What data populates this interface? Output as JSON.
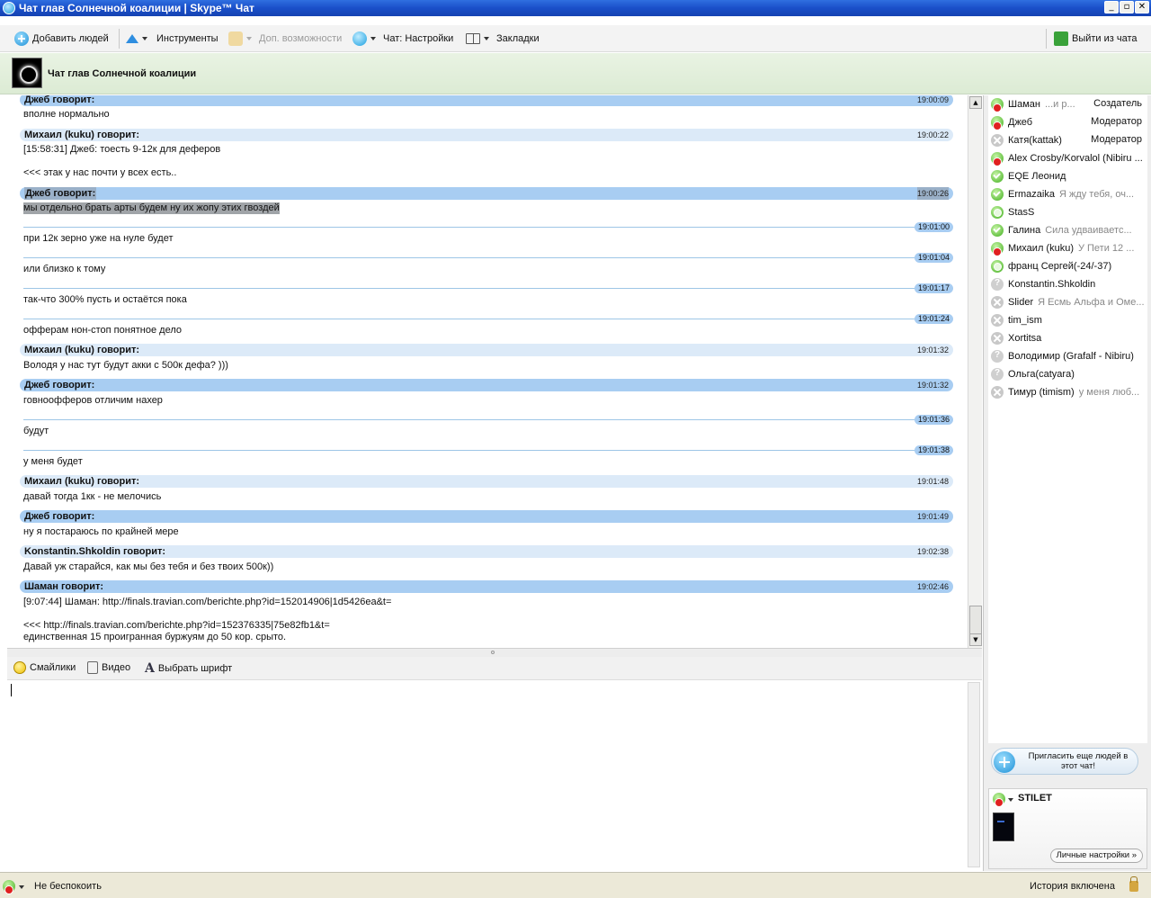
{
  "window": {
    "title": "Чат глав Солнечной коалиции | Skype™ Чат",
    "minimize": "_",
    "maximize": "▫",
    "close": "✕"
  },
  "toolbar": {
    "add_people": "Добавить людей",
    "tools": "Инструменты",
    "extras": "Доп. возможности",
    "chat_settings": "Чат: Настройки",
    "bookmarks": "Закладки",
    "leave": "Выйти из чата"
  },
  "chat": {
    "title": "Чат глав Солнечной коалиции"
  },
  "messages": {
    "h1": {
      "who": "Джеб говорит:",
      "time": "19:00:09"
    },
    "l1": "вполне нормально",
    "h2": {
      "who": "Михаил (kuku) говорит:",
      "time": "19:00:22"
    },
    "l2": "[15:58:31] Джеб: тоесть 9-12к для деферов",
    "l3": "<<< этак у нас почти у всех есть..",
    "h3": {
      "who": "Джеб говорит:",
      "time": "19:00:26"
    },
    "l4": "мы отдельно брать арты будем ну их жопу этих гвоздей",
    "t1": "19:01:00",
    "l5": "при 12к зерно уже на нуле будет",
    "t2": "19:01:04",
    "l6": "или близко к тому",
    "t3": "19:01:17",
    "l7": "так-что 300% пусть и остаётся пока",
    "t4": "19:01:24",
    "l8": "офферам нон-стоп понятное дело",
    "h4": {
      "who": "Михаил (kuku) говорит:",
      "time": "19:01:32"
    },
    "l9": "Володя у нас тут будут акки с 500к дефа? )))",
    "h5": {
      "who": "Джеб говорит:",
      "time": "19:01:32"
    },
    "l10": "говноофферов отличим нахер",
    "t5": "19:01:36",
    "l11": "будут",
    "t6": "19:01:38",
    "l12": "у меня будет",
    "h6": {
      "who": "Михаил (kuku) говорит:",
      "time": "19:01:48"
    },
    "l13": "давай тогда 1кк - не мелочись",
    "h7": {
      "who": "Джеб говорит:",
      "time": "19:01:49"
    },
    "l14": "ну я постараюсь по крайней мере",
    "h8": {
      "who": "Konstantin.Shkoldin говорит:",
      "time": "19:02:38"
    },
    "l15": "Давай уж старайся, как мы без тебя и без твоих 500к))",
    "h9": {
      "who": "Шаман говорит:",
      "time": "19:02:46"
    },
    "l16": "[9:07:44] Шаман: http://finals.travian.com/berichte.php?id=152014906|1d5426ea&t=",
    "l17": "<<< http://finals.travian.com/berichte.php?id=152376335|75e82fb1&t=",
    "l18": "единственная 15 проигранная буржуям до 50 кор. срыто."
  },
  "compose_bar": {
    "smileys": "Смайлики",
    "video": "Видео",
    "font": "Выбрать шрифт",
    "font_glyph": "A"
  },
  "participants": [
    {
      "name": "Шаман",
      "mood": "...и р...",
      "role": "Создатель",
      "status": "dnd"
    },
    {
      "name": "Джеб",
      "mood": "",
      "role": "Модератор",
      "status": "dnd"
    },
    {
      "name": "Катя(kattak)",
      "mood": "",
      "role": "Модератор",
      "status": "offline"
    },
    {
      "name": "Alex Crosby/Korvalol (Nibiru ...",
      "mood": "",
      "role": "",
      "status": "dnd"
    },
    {
      "name": "EQE Леонид",
      "mood": "",
      "role": "",
      "status": "online"
    },
    {
      "name": "Ermazaika",
      "mood": "Я жду тебя, оч...",
      "role": "",
      "status": "online"
    },
    {
      "name": "StasS",
      "mood": "",
      "role": "",
      "status": "away"
    },
    {
      "name": "Галина",
      "mood": "Сила удваиваетс...",
      "role": "",
      "status": "online"
    },
    {
      "name": "Михаил (kuku)",
      "mood": "У Пети 12 ...",
      "role": "",
      "status": "dnd"
    },
    {
      "name": "франц Сергей(-24/-37)",
      "mood": "",
      "role": "",
      "status": "away"
    },
    {
      "name": "Konstantin.Shkoldin",
      "mood": "",
      "role": "",
      "status": "unknown"
    },
    {
      "name": "Slider",
      "mood": "Я Есмь Альфа и Оме...",
      "role": "",
      "status": "offline"
    },
    {
      "name": "tim_ism",
      "mood": "",
      "role": "",
      "status": "offline"
    },
    {
      "name": "Xortitsa",
      "mood": "",
      "role": "",
      "status": "offline"
    },
    {
      "name": "Володимир (Grafalf - Nibiru)",
      "mood": "",
      "role": "",
      "status": "unknown"
    },
    {
      "name": "Ольга(catyara)",
      "mood": "",
      "role": "",
      "status": "unknown"
    },
    {
      "name": "Тимур (timism)",
      "mood": "у меня люб...",
      "role": "",
      "status": "offline"
    }
  ],
  "invite": {
    "label": "Пригласить еще людей в этот чат!"
  },
  "profile": {
    "name": "STILET",
    "settings": "Личные настройки »"
  },
  "statusbar": {
    "status": "Не беспокоить",
    "history": "История включена"
  },
  "colors": {
    "title_bar": "#1a4fc9",
    "self_header": "#a8cdf2",
    "other_header": "#dceaf8",
    "header_bg": "#dcebd4"
  }
}
